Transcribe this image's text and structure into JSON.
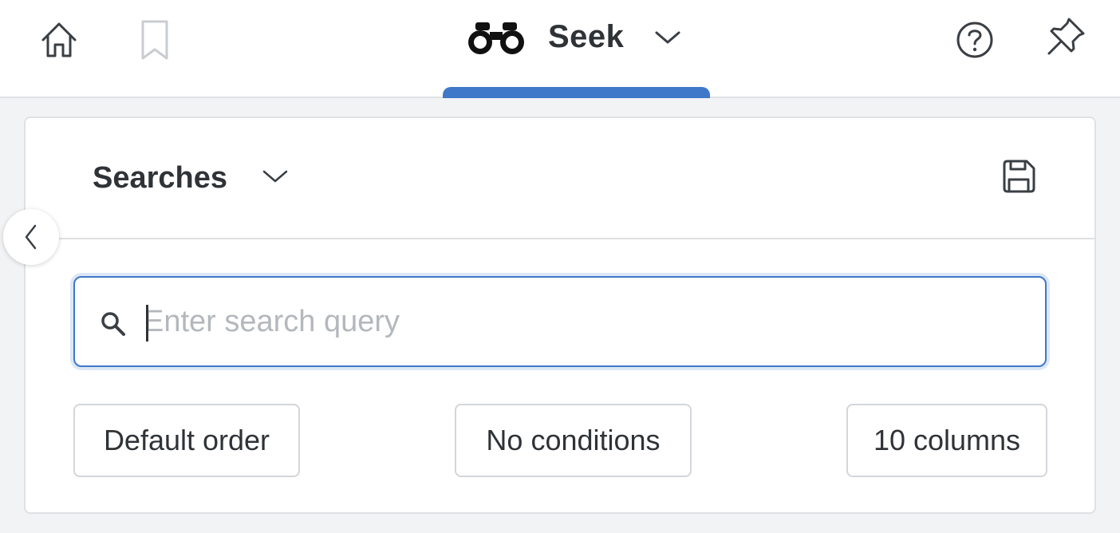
{
  "topbar": {
    "app_name": "Seek",
    "icons": [
      "home-icon",
      "bookmark-icon",
      "binoculars-icon",
      "chevron-down-icon",
      "help-icon",
      "pin-icon"
    ],
    "accent_color": "#3f78c9"
  },
  "panel": {
    "title": "Searches",
    "save_icon": "save-icon"
  },
  "search": {
    "placeholder": "Enter search query",
    "value": ""
  },
  "chips": {
    "order_label": "Default order",
    "conditions_label": "No conditions",
    "columns_label": "10 columns"
  }
}
